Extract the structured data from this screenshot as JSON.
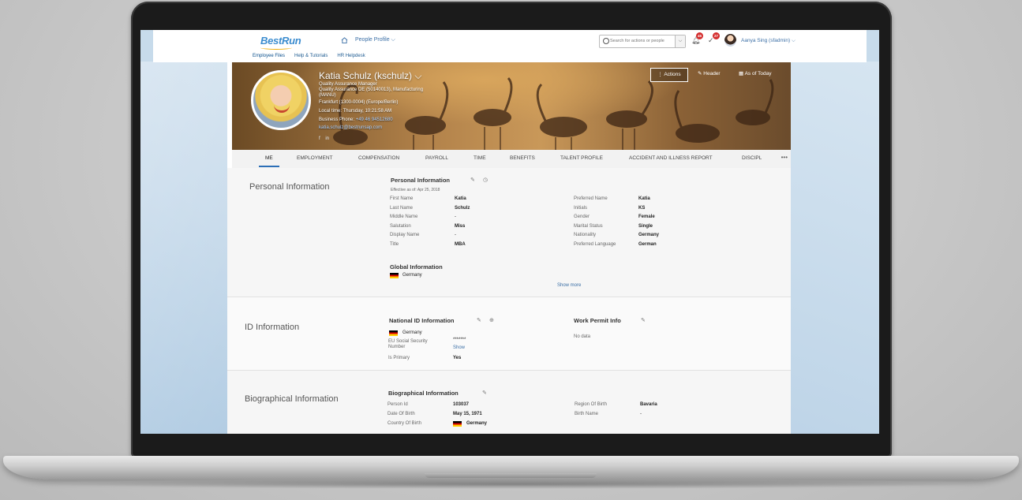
{
  "shell": {
    "logo": "BestRun",
    "module": "People Profile",
    "sub_links": [
      "Employee Files",
      "Help & Tutorials",
      "HR Helpdesk"
    ],
    "search_placeholder": "Search for actions or people",
    "notifications_count": "45",
    "todo_count": "27",
    "user": "Aanya Sing (sfadmin)"
  },
  "header": {
    "name": "Katia Schulz (kschulz)",
    "job_title": "Quality Assurance Manager",
    "department": "Quality Assurance DE (50140013), Manufacturing",
    "department2": "(MANU)",
    "location": "Frankfurt (1300-0004) (Europe/Berlin)",
    "local_time": "Local time: Thursday, 10:21:58 AM",
    "business_phone_label": "Business Phone:",
    "business_phone": "+49 46 94512680",
    "email": "katia.schulz@bestrunsap.com",
    "actions": "Actions",
    "header_btn": "Header",
    "as_of": "As of Today"
  },
  "tabs": [
    "ME",
    "EMPLOYMENT",
    "COMPENSATION",
    "PAYROLL",
    "TIME",
    "BENEFITS",
    "TALENT PROFILE",
    "ACCIDENT AND ILLNESS REPORT",
    "DISCIPL"
  ],
  "personal": {
    "section": "Personal Information",
    "card": "Personal Information",
    "effective": "Effective as of: Apr 25, 2018",
    "left": [
      {
        "label": "First Name",
        "value": "Katia"
      },
      {
        "label": "Last Name",
        "value": "Schulz"
      },
      {
        "label": "Middle Name",
        "value": "-"
      },
      {
        "label": "Salutation",
        "value": "Miss"
      },
      {
        "label": "Display Name",
        "value": "-"
      },
      {
        "label": "Title",
        "value": "MBA"
      }
    ],
    "right": [
      {
        "label": "Preferred Name",
        "value": "Katia"
      },
      {
        "label": "Initials",
        "value": "KS"
      },
      {
        "label": "Gender",
        "value": "Female"
      },
      {
        "label": "Marital Status",
        "value": "Single"
      },
      {
        "label": "Nationality",
        "value": "Germany"
      },
      {
        "label": "Preferred Language",
        "value": "German"
      }
    ],
    "global_title": "Global Information",
    "global_country": "Germany",
    "show_more": "Show more"
  },
  "id_info": {
    "section": "ID Information",
    "card": "National ID Information",
    "country": "Germany",
    "eu_label": "EU Social Security Number",
    "eu_value": "*******",
    "show": "Show",
    "primary_label": "Is Primary",
    "primary_value": "Yes",
    "permit_title": "Work Permit Info",
    "permit_value": "No data"
  },
  "bio": {
    "section": "Biographical Information",
    "card": "Biographical Information",
    "person_id_label": "Person Id",
    "person_id": "103037",
    "dob_label": "Date Of Birth",
    "dob": "May 15, 1971",
    "cob_label": "Country Of Birth",
    "cob": "Germany",
    "region_label": "Region Of Birth",
    "region": "Bavaria",
    "birth_name_label": "Birth Name",
    "birth_name": "-"
  }
}
